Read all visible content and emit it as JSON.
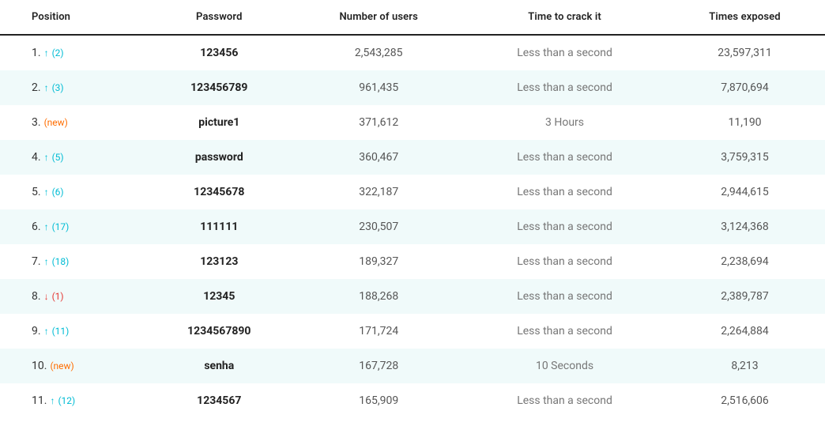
{
  "headers": {
    "position": "Position",
    "password": "Password",
    "users": "Number of users",
    "crack": "Time to crack it",
    "exposed": "Times exposed"
  },
  "rows": [
    {
      "pos": "1.",
      "arrow": "up",
      "change": "(2)",
      "changeType": "up",
      "password": "123456",
      "users": "2,543,285",
      "crack": "Less than a second",
      "exposed": "23,597,311"
    },
    {
      "pos": "2.",
      "arrow": "up",
      "change": "(3)",
      "changeType": "up",
      "password": "123456789",
      "users": "961,435",
      "crack": "Less than a second",
      "exposed": "7,870,694"
    },
    {
      "pos": "3.",
      "arrow": "none",
      "change": "(new)",
      "changeType": "new",
      "password": "picture1",
      "users": "371,612",
      "crack": "3 Hours",
      "exposed": "11,190"
    },
    {
      "pos": "4.",
      "arrow": "up",
      "change": "(5)",
      "changeType": "up",
      "password": "password",
      "users": "360,467",
      "crack": "Less than a second",
      "exposed": "3,759,315"
    },
    {
      "pos": "5.",
      "arrow": "up",
      "change": "(6)",
      "changeType": "up",
      "password": "12345678",
      "users": "322,187",
      "crack": "Less than a second",
      "exposed": "2,944,615"
    },
    {
      "pos": "6.",
      "arrow": "up",
      "change": "(17)",
      "changeType": "up",
      "password": "111111",
      "users": "230,507",
      "crack": "Less than a second",
      "exposed": "3,124,368"
    },
    {
      "pos": "7.",
      "arrow": "up",
      "change": "(18)",
      "changeType": "up",
      "password": "123123",
      "users": "189,327",
      "crack": "Less than a second",
      "exposed": "2,238,694"
    },
    {
      "pos": "8.",
      "arrow": "down",
      "change": "(1)",
      "changeType": "down",
      "password": "12345",
      "users": "188,268",
      "crack": "Less than a second",
      "exposed": "2,389,787"
    },
    {
      "pos": "9.",
      "arrow": "up",
      "change": "(11)",
      "changeType": "up",
      "password": "1234567890",
      "users": "171,724",
      "crack": "Less than a second",
      "exposed": "2,264,884"
    },
    {
      "pos": "10.",
      "arrow": "none",
      "change": "(new)",
      "changeType": "new",
      "password": "senha",
      "users": "167,728",
      "crack": "10 Seconds",
      "exposed": "8,213"
    },
    {
      "pos": "11.",
      "arrow": "up",
      "change": "(12)",
      "changeType": "up",
      "password": "1234567",
      "users": "165,909",
      "crack": "Less than a second",
      "exposed": "2,516,606"
    }
  ]
}
